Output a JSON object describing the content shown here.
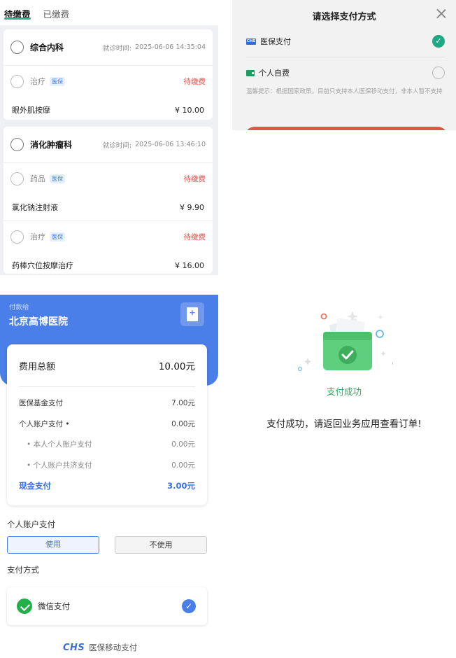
{
  "unpaid_list": {
    "tabs": [
      {
        "label": "待缴费",
        "active": true
      },
      {
        "label": "已缴费",
        "active": false
      }
    ],
    "visit_time_label": "就诊时间:",
    "accent_color": "#2fb48c",
    "records": [
      {
        "department": "综合内科",
        "visit_time": "2025-06-06 14:35:04",
        "items": [
          {
            "type": "治疗",
            "badge": "医保",
            "status": "待缴费",
            "name": "眼外肌按摩",
            "price": "¥ 10.00"
          }
        ]
      },
      {
        "department": "消化肿瘤科",
        "visit_time": "2025-06-06 13:46:10",
        "items": [
          {
            "type": "药品",
            "badge": "医保",
            "status": "待缴费",
            "name": "氯化钠注射液",
            "price": "¥ 9.90"
          },
          {
            "type": "治疗",
            "badge": "医保",
            "status": "待缴费",
            "name": "药棒穴位按摩治疗",
            "price": "¥ 16.00"
          }
        ]
      }
    ]
  },
  "pay_method_sheet": {
    "title": "请选择支付方式",
    "options": [
      {
        "label": "医保支付",
        "icon": "chs-icon",
        "selected": true
      },
      {
        "label": "个人自费",
        "icon": "wallet-icon",
        "selected": false
      }
    ],
    "tip": "温馨提示：根据国家政策，目前只支持本人医保移动支付，非本人暂不支持",
    "chs_badge_text": "CHS"
  },
  "payment_detail": {
    "pay_to_label": "付款给",
    "hospital": "北京高博医院",
    "total_label": "费用总额",
    "total_value": "10.00元",
    "rows": [
      {
        "label": "医保基金支付",
        "value": "7.00元"
      },
      {
        "label": "个人账户支付 •",
        "value": "0.00元"
      },
      {
        "label": "• 本人个人账户支付",
        "value": "0.00元"
      },
      {
        "label": "• 个人账户共济支付",
        "value": "0.00元"
      },
      {
        "label": "现金支付",
        "value": "3.00元"
      }
    ],
    "personal_account_label": "个人账户支付",
    "use_label": "使用",
    "not_use_label": "不使用",
    "pay_method_label": "支付方式",
    "wechat_label": "微信支付",
    "brand_logo": "CHS",
    "brand_text": "医保移动支付",
    "header_color": "#4a7ee8"
  },
  "success": {
    "status": "支付成功",
    "message": "支付成功，请返回业务应用查看订单!",
    "color": "#33a35f"
  }
}
